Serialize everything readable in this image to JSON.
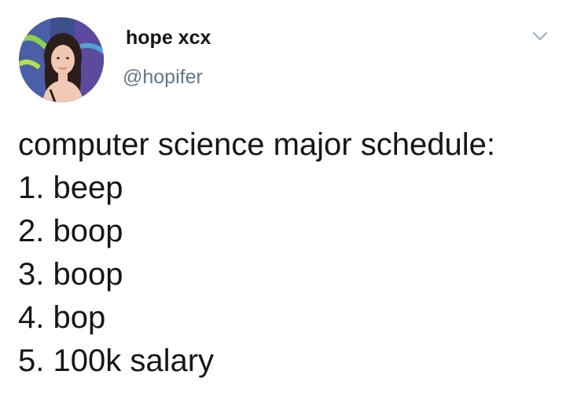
{
  "tweet": {
    "author": {
      "display_name": "hope xcx",
      "handle": "@hopifer",
      "avatar_icon": "profile-photo"
    },
    "menu_icon": "chevron-down-icon",
    "text_lines": [
      "computer science major schedule:",
      "1. beep",
      "2. boop",
      "3. boop",
      "4. bop",
      "5. 100k salary"
    ]
  },
  "colors": {
    "name": "#14171a",
    "handle": "#657786",
    "body_text": "#14171a",
    "chevron": "#aab8c2",
    "background": "#ffffff"
  }
}
